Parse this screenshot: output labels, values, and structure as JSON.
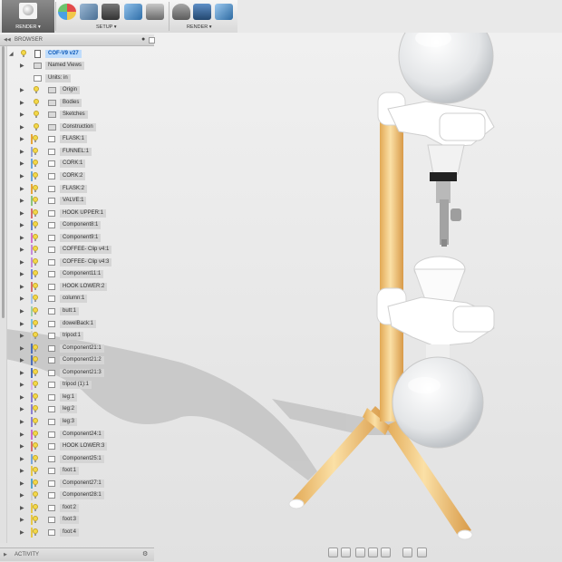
{
  "toolbar": {
    "render_tab": "RENDER ▾",
    "setup_label": "SETUP ▾",
    "render_label": "RENDER ▾"
  },
  "browser": {
    "title": "BROWSER",
    "root": "COF-V9 v27",
    "items": [
      {
        "label": "Named Views",
        "kind": "folder"
      },
      {
        "label": "Units: in",
        "kind": "doc"
      },
      {
        "label": "Origin",
        "kind": "folder"
      },
      {
        "label": "Bodies",
        "kind": "folder"
      },
      {
        "label": "Sketches",
        "kind": "folder"
      },
      {
        "label": "Construction",
        "kind": "folder"
      },
      {
        "label": "FLASK:1",
        "kind": "comp",
        "color": "#e6a53a"
      },
      {
        "label": "FUNNEL:1",
        "kind": "comp",
        "color": "#9aa7d6"
      },
      {
        "label": "CORK:1",
        "kind": "comp",
        "color": "#6ea6d8"
      },
      {
        "label": "CORK:2",
        "kind": "comp",
        "color": "#6ea6d8"
      },
      {
        "label": "FLASK:2",
        "kind": "comp",
        "color": "#e6a53a"
      },
      {
        "label": "VALVE:1",
        "kind": "comp",
        "color": "#8ec57a"
      },
      {
        "label": "HOOK UPPER:1",
        "kind": "comp",
        "color": "#d66f6f"
      },
      {
        "label": "Component8:1",
        "kind": "comp",
        "color": "#6a86c9"
      },
      {
        "label": "Component9:1",
        "kind": "comp",
        "color": "#d674c7"
      },
      {
        "label": "COFFEE- Clip v4:1",
        "kind": "comp",
        "color": "#c78bd9"
      },
      {
        "label": "COFFEE- Clip v4:3",
        "kind": "comp",
        "color": "#c78bd9"
      },
      {
        "label": "Component11:1",
        "kind": "comp",
        "color": "#7a86d4"
      },
      {
        "label": "HOOK LOWER:2",
        "kind": "comp",
        "color": "#d66f6f"
      },
      {
        "label": "column:1",
        "kind": "comp",
        "color": "#a9c4e8"
      },
      {
        "label": "butt:1",
        "kind": "comp",
        "color": "#9fd1a8"
      },
      {
        "label": "dowelBack:1",
        "kind": "comp",
        "color": "#7dc0e0"
      },
      {
        "label": "tripod:1",
        "kind": "comp",
        "color": "#cfcfcf"
      },
      {
        "label": "Component21:1",
        "kind": "comp",
        "color": "#4f6fb7"
      },
      {
        "label": "Component21:2",
        "kind": "comp",
        "color": "#4f6fb7"
      },
      {
        "label": "Component21:3",
        "kind": "comp",
        "color": "#4f6fb7"
      },
      {
        "label": "tripod (1):1",
        "kind": "comp",
        "color": "#d8b4e6"
      },
      {
        "label": "leg:1",
        "kind": "comp",
        "color": "#8c7fd1"
      },
      {
        "label": "leg:2",
        "kind": "comp",
        "color": "#8c7fd1"
      },
      {
        "label": "leg:3",
        "kind": "comp",
        "color": "#8c7fd1"
      },
      {
        "label": "Component24:1",
        "kind": "comp",
        "color": "#c96fd0"
      },
      {
        "label": "HOOK LOWER:3",
        "kind": "comp",
        "color": "#d66f6f"
      },
      {
        "label": "Component25:1",
        "kind": "comp",
        "color": "#7aa7d8"
      },
      {
        "label": "foot:1",
        "kind": "comp",
        "color": "#e6c84a"
      },
      {
        "label": "Component27:1",
        "kind": "comp",
        "color": "#5aa7c9"
      },
      {
        "label": "Component28:1",
        "kind": "comp",
        "color": "#cfcfcf"
      },
      {
        "label": "foot:2",
        "kind": "comp",
        "color": "#e6c84a"
      },
      {
        "label": "foot:3",
        "kind": "comp",
        "color": "#e6c84a"
      },
      {
        "label": "foot:4",
        "kind": "comp",
        "color": "#e6c84a"
      }
    ]
  },
  "activity": {
    "title": "ACTIVITY"
  },
  "colors": {
    "wood": "#f0c878",
    "plastic": "#ffffff",
    "accent": "#0b58b8"
  }
}
